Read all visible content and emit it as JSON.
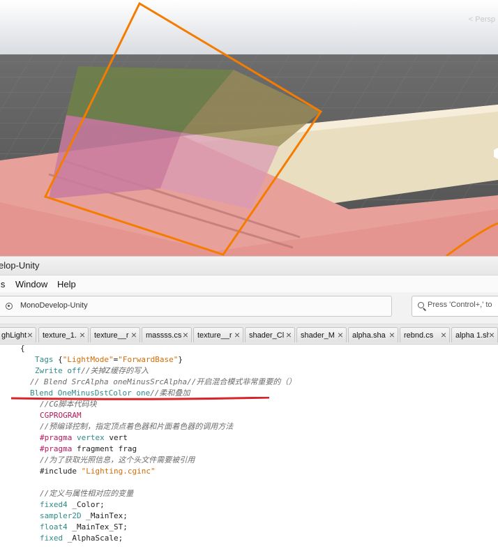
{
  "scene": {
    "name": "unity-scene-view",
    "faded_label": "< Persp"
  },
  "window": {
    "title": "elop-Unity"
  },
  "menu": {
    "items": [
      "ls",
      "Window",
      "Help"
    ]
  },
  "toolbar": {
    "status_text": "MonoDevelop-Unity",
    "search_placeholder": "Press 'Control+,' to"
  },
  "tabs": [
    {
      "label": "ghLight"
    },
    {
      "label": "texture_1."
    },
    {
      "label": "texture__r"
    },
    {
      "label": "massss.cs"
    },
    {
      "label": "texture__r"
    },
    {
      "label": "shader_Cl"
    },
    {
      "label": "shader_M"
    },
    {
      "label": "alpha.sha"
    },
    {
      "label": "rebnd.cs"
    },
    {
      "label": "alpha 1.sh"
    }
  ],
  "code": {
    "open_brace": "{",
    "tags_kw": "Tags",
    "tags_open": " {",
    "tags_key": "\"LightMode\"",
    "tags_eq": "=",
    "tags_val": "\"ForwardBase\"",
    "tags_close": "}",
    "zwrite_kw": "Zwrite off",
    "zwrite_cmt": "//关掉Z缓存的写入",
    "blend_cmt": "// Blend SrcAlpha oneMinusSrcAlpha//开启混合模式非常重要的（）",
    "blend_kw": "Blend OneMinusDstColor one",
    "blend_cmt2": "//柔和叠加",
    "cg_cmt": "//CG脚本代码块",
    "cgprogram": "CGPROGRAM",
    "pre_cmt": "//预编译控制，指定顶点着色器和片面着色器的调用方法",
    "pragma1_kw": "#pragma",
    "pragma1_a": " vertex",
    "pragma1_b": " vert",
    "pragma2_kw": "#pragma",
    "pragma2_b": " fragment frag",
    "light_cmt": "//为了获取光照信息，这个头文件需要被引用",
    "include_kw": "#include",
    "include_val": " \"Lighting.cginc\"",
    "def_cmt": "//定义与属性相对应的变量",
    "fixed4_kw": "fixed4",
    "fixed4_var": " _Color;",
    "sampler_kw": "sampler2D",
    "sampler_var": " _MainTex;",
    "float4_kw": "float4",
    "float4_var": " _MainTex_ST;",
    "fixed_kw": "fixed",
    "fixed_var": " _AlphaScale;"
  },
  "colors": {
    "keyword": "#2c8b8b",
    "string": "#d96b00",
    "comment": "#6c6c6c",
    "preprocessor": "#b5165c",
    "annotation_underline": "#d8252a",
    "selection_outline": "#f57c00"
  }
}
